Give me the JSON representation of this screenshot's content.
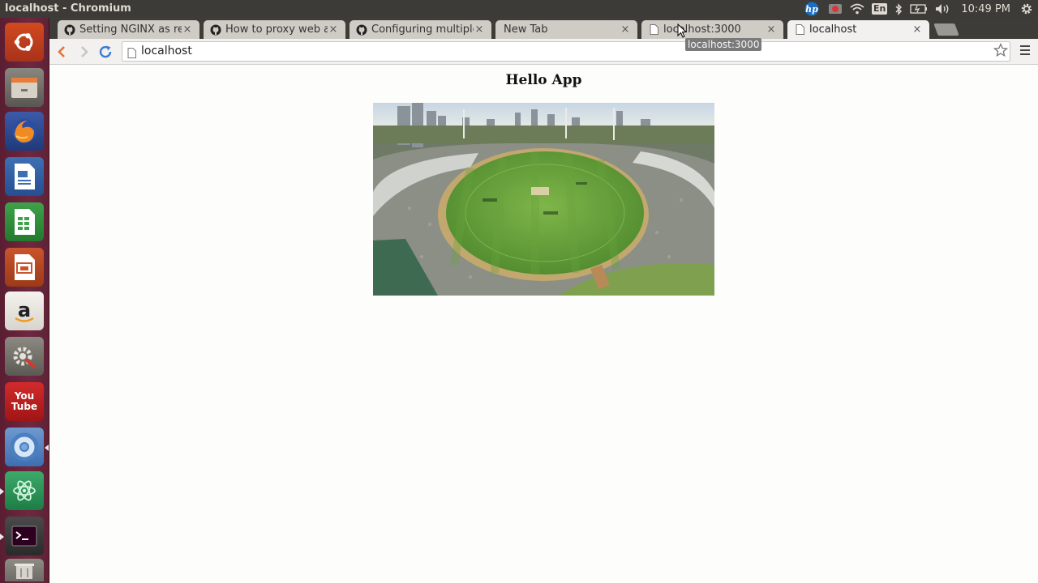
{
  "system": {
    "window_title": "localhost - Chromium",
    "keyboard_layout": "En",
    "clock": "10:49 PM",
    "tray_icons": [
      "hp-icon",
      "record-icon",
      "wifi-icon",
      "keyboard-layout-indicator",
      "bluetooth-icon",
      "battery-icon",
      "volume-icon",
      "settings-gear-icon"
    ]
  },
  "launcher": {
    "items": [
      "ubuntu-dash-icon",
      "files-icon",
      "firefox-icon",
      "writer-icon",
      "calc-icon",
      "impress-icon",
      "amazon-icon",
      "system-settings-icon",
      "youtube-icon",
      "chromium-icon",
      "atom-icon",
      "terminal-icon",
      "trash-icon"
    ],
    "youtube_text_top": "You",
    "youtube_text_bottom": "Tube"
  },
  "browser": {
    "tabs": [
      {
        "title": "Setting NGINX as reve",
        "favicon": "github-icon",
        "active": false
      },
      {
        "title": "How to proxy web app",
        "favicon": "github-icon",
        "active": false
      },
      {
        "title": "Configuring multiple",
        "favicon": "github-icon",
        "active": false
      },
      {
        "title": "New Tab",
        "favicon": "",
        "active": false
      },
      {
        "title": "localhost:3000",
        "favicon": "page-icon",
        "active": false
      },
      {
        "title": "localhost",
        "favicon": "page-icon",
        "active": true
      }
    ],
    "tab_close_glyph": "×",
    "address": "localhost",
    "tooltip": "localhost:3000"
  },
  "page": {
    "heading": "Hello App",
    "image_description_name": "cricket-stadium-image"
  },
  "colors": {
    "launcher": "#6e2840",
    "topbar": "#3c3b37",
    "tab_active": "#f2f1f0",
    "tab_inactive": "#cfccc6",
    "refresh_blue": "#3a7bd5",
    "back_orange": "#e2733b"
  }
}
